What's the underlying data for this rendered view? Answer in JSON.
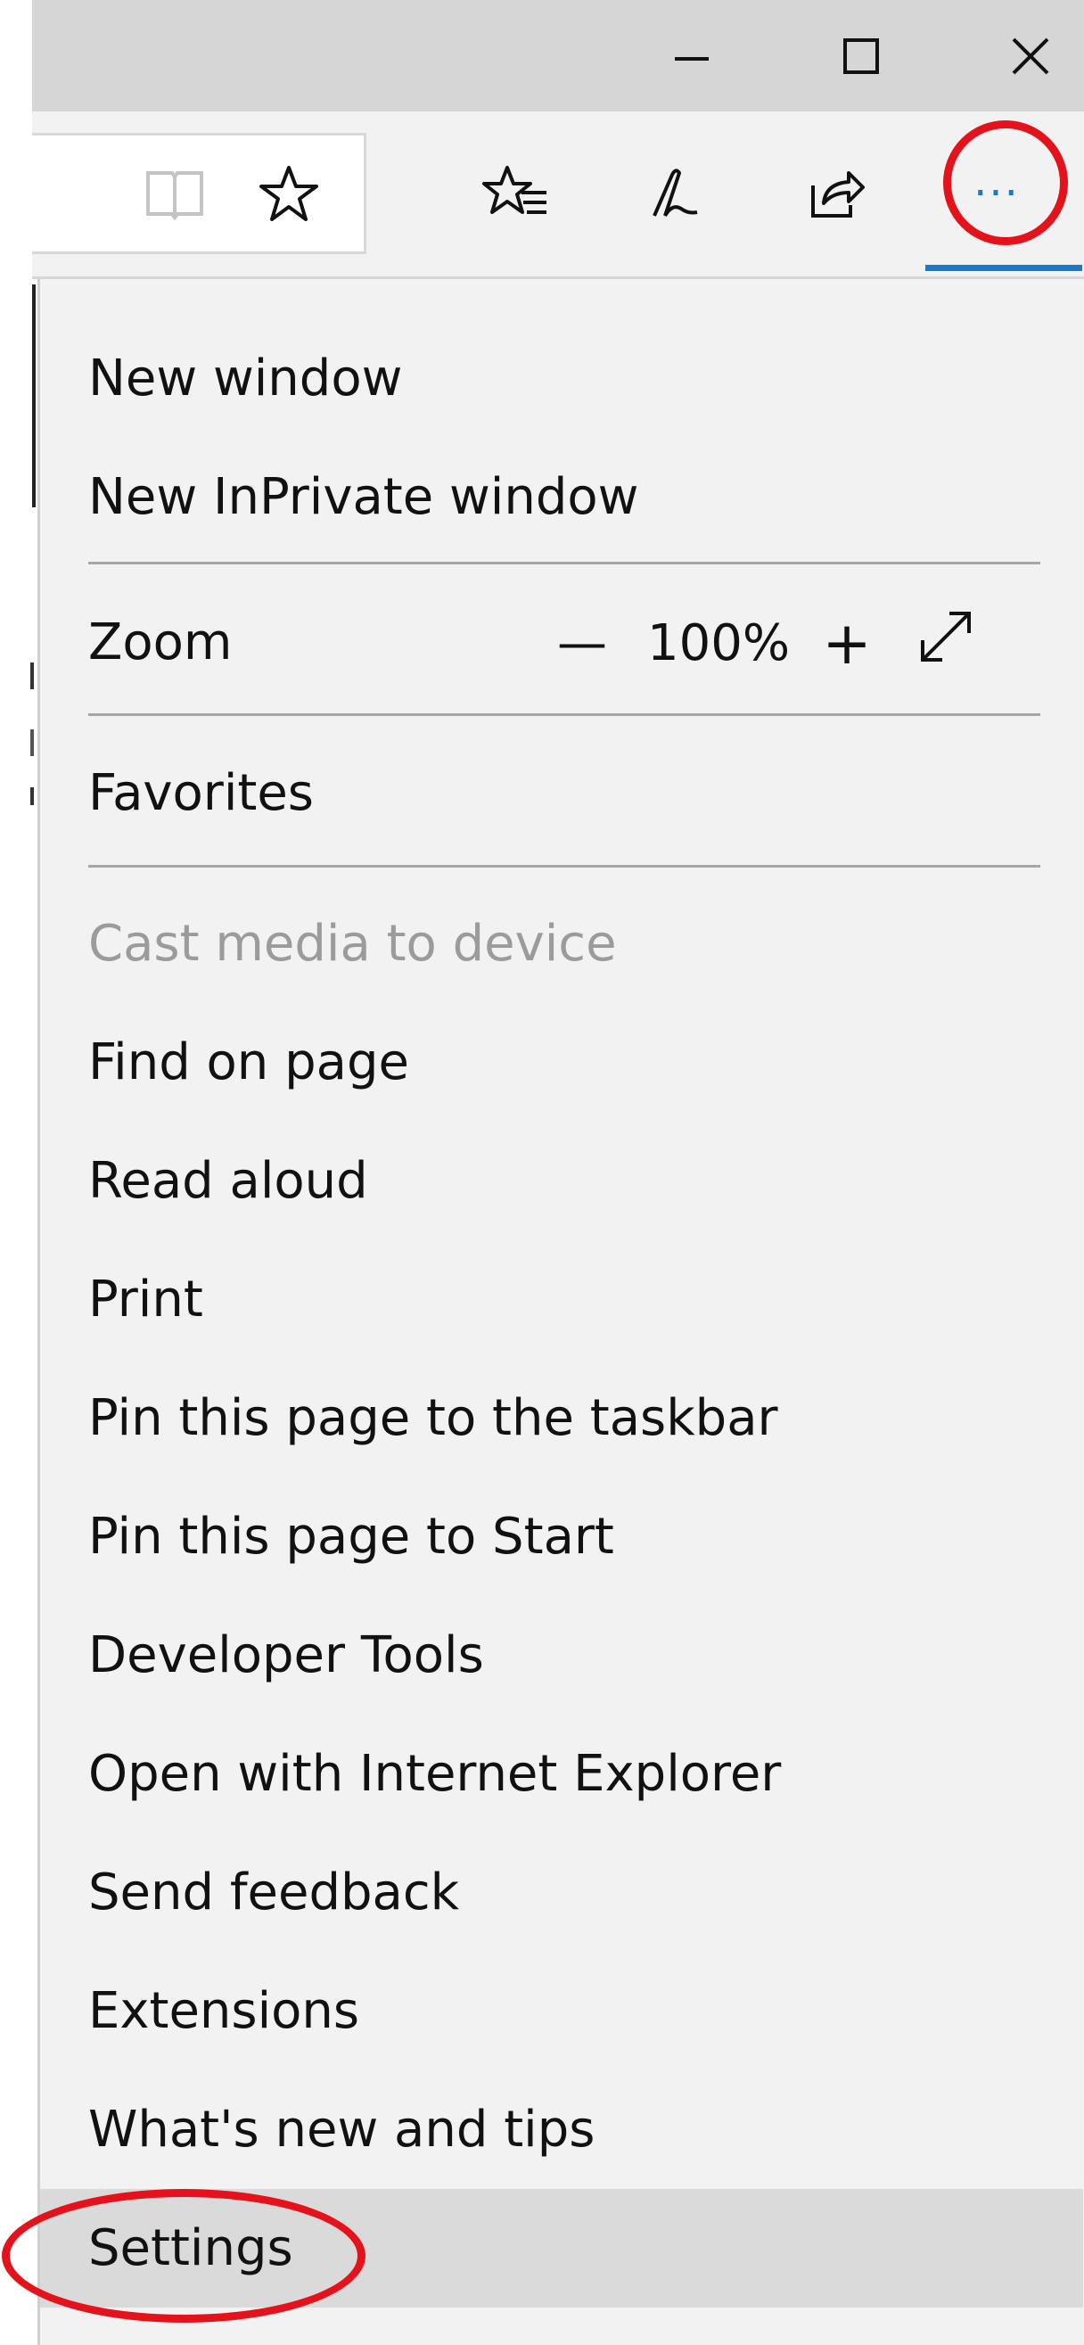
{
  "window_controls": {
    "minimize_icon": "minimize-icon",
    "maximize_icon": "maximize-icon",
    "close_icon": "close-icon"
  },
  "toolbar": {
    "icons": [
      "reading-view-icon",
      "favorite-star-icon",
      "favorites-hub-icon",
      "web-note-icon",
      "share-icon",
      "more-ellipsis-icon"
    ],
    "more_label": "···",
    "accent_color": "#1979ca",
    "highlight_color": "#e4121b"
  },
  "menu": {
    "new_window": "New window",
    "new_inprivate_window": "New InPrivate window",
    "zoom": {
      "label": "Zoom",
      "minus": "—",
      "value": "100%",
      "plus": "+",
      "fullscreen_icon": "fullscreen-icon"
    },
    "favorites": "Favorites",
    "cast_media": "Cast media to device",
    "find_on_page": "Find on page",
    "read_aloud": "Read aloud",
    "print": "Print",
    "pin_taskbar": "Pin this page to the taskbar",
    "pin_start": "Pin this page to Start",
    "developer_tools": "Developer Tools",
    "open_ie": "Open with Internet Explorer",
    "send_feedback": "Send feedback",
    "extensions": "Extensions",
    "whats_new": "What's new and tips",
    "settings": "Settings"
  }
}
